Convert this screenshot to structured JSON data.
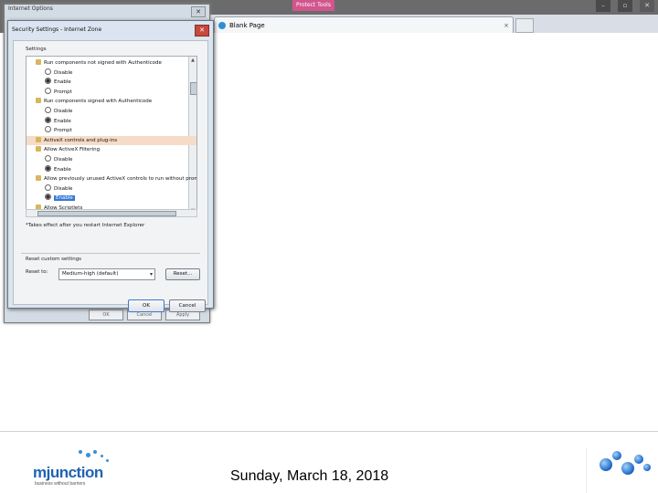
{
  "ie": {
    "tab_title": "Blank Page",
    "tab_close": "×",
    "highlight_chip": "Protect Tools",
    "window_buttons": [
      "–",
      "▫",
      "✕"
    ]
  },
  "internet_options": {
    "title": "Internet Options",
    "close": "✕",
    "buttons": [
      "OK",
      "Cancel",
      "Apply"
    ]
  },
  "security": {
    "title": "Security Settings - Internet Zone",
    "close": "✕",
    "settings_label": "Settings",
    "rows": [
      {
        "kind": "cat",
        "text": "Run components not signed with Authenticode"
      },
      {
        "kind": "radio",
        "on": false,
        "text": "Disable"
      },
      {
        "kind": "radio",
        "on": true,
        "text": "Enable"
      },
      {
        "kind": "radio",
        "on": false,
        "text": "Prompt"
      },
      {
        "kind": "cat",
        "text": "Run components signed with Authenticode"
      },
      {
        "kind": "radio",
        "on": false,
        "text": "Disable"
      },
      {
        "kind": "radio",
        "on": true,
        "text": "Enable"
      },
      {
        "kind": "radio",
        "on": false,
        "text": "Prompt"
      },
      {
        "kind": "cat",
        "text": "ActiveX controls and plug-ins",
        "highlight": true
      },
      {
        "kind": "cat",
        "text": "Allow ActiveX Filtering"
      },
      {
        "kind": "radio",
        "on": false,
        "text": "Disable"
      },
      {
        "kind": "radio",
        "on": true,
        "text": "Enable"
      },
      {
        "kind": "cat",
        "text": "Allow previously unused ActiveX controls to run without prom"
      },
      {
        "kind": "radio",
        "on": false,
        "text": "Disable"
      },
      {
        "kind": "radio",
        "on": true,
        "text": "Enable",
        "selected": true
      },
      {
        "kind": "cat",
        "text": "Allow Scriptlets"
      }
    ],
    "note": "*Takes effect after you restart Internet Explorer",
    "reset_group": "Reset custom settings",
    "reset_to_label": "Reset to:",
    "reset_value": "Medium-high (default)",
    "reset_button": "Reset...",
    "ok_button": "OK",
    "cancel_button": "Cancel"
  },
  "footer": {
    "date": "Sunday, March 18, 2018",
    "logo_text": "mjunction",
    "logo_tagline": "business without barriers"
  }
}
